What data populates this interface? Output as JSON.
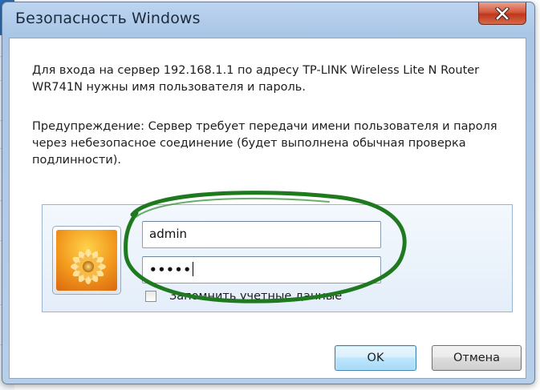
{
  "window": {
    "title": "Безопасность Windows",
    "close_icon": "close-x-icon"
  },
  "message": {
    "line1": "Для входа на сервер 192.168.1.1 по адресу TP-LINK Wireless Lite N Router WR741N нужны имя пользователя и пароль.",
    "warning": "Предупреждение: Сервер требует передачи имени пользователя и пароля через небезопасное соединение (будет выполнена обычная проверка подлинности)."
  },
  "credentials": {
    "avatar_icon": "user-avatar-flower-icon",
    "username_value": "admin",
    "password_value": "•••••",
    "remember_label": "Запомнить учетные данные",
    "remember_checked": false
  },
  "buttons": {
    "ok_label": "OK",
    "cancel_label": "Отмена"
  },
  "colors": {
    "annotation_ellipse": "#1f7a1f",
    "close_button": "#c7432a",
    "ok_border": "#3c7fb1"
  }
}
